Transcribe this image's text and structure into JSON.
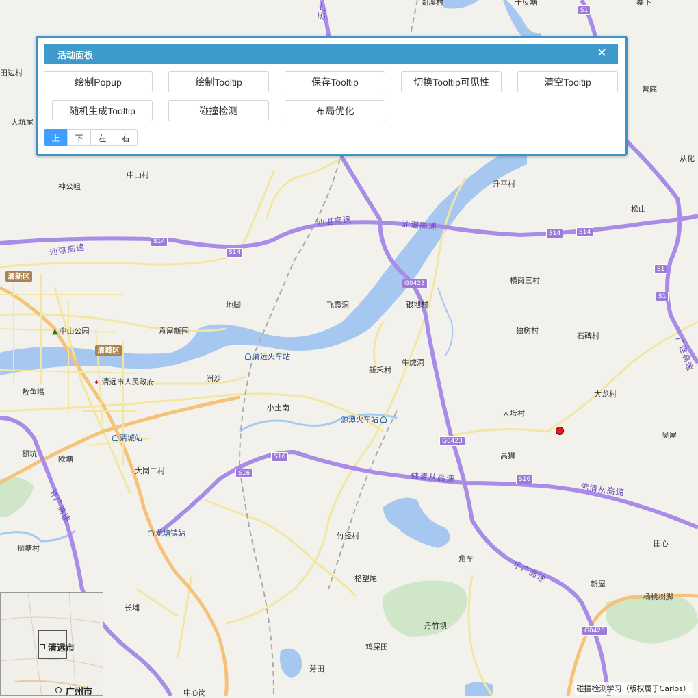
{
  "panel": {
    "title": "活动面板",
    "close_symbol": "✕",
    "buttons": [
      "绘制Popup",
      "绘制Tooltip",
      "保存Tooltip",
      "切换Tooltip可见性",
      "清空Tooltip",
      "随机生成Tooltip",
      "碰撞检测",
      "布局优化"
    ],
    "directions": [
      "上",
      "下",
      "左",
      "右"
    ],
    "active_direction": "上"
  },
  "map": {
    "places": [
      "湖溪村",
      "十反塘",
      "寨下",
      "田边村",
      "营底",
      "大坑尾",
      "从化",
      "中山村",
      "神公咀",
      "升平村",
      "松山",
      "横岗三村",
      "地脚",
      "飞霞洞",
      "银地村",
      "独树村",
      "石碑村",
      "袁屋新围",
      "新禾村",
      "牛虎洞",
      "洲沙",
      "清远市人民政府",
      "敖鱼嘴",
      "小土南",
      "大龙村",
      "大坻村",
      "吴屋",
      "额坑",
      "欧塘",
      "高狮",
      "大岗二村",
      "狮塘村",
      "竹径村",
      "田心",
      "角车",
      "格塑尾",
      "新屋",
      "杨桃树脚",
      "长埔",
      "丹竹坝",
      "鸡屎田",
      "芳田",
      "中心岗"
    ],
    "stations": [
      "清远火车站",
      "源潭火车站",
      "清城站",
      "龙塘镇站"
    ],
    "parks": [
      "中山公园"
    ],
    "districts": [
      "清新区",
      "清城区"
    ],
    "road_names": [
      "汕湛高速",
      "汕湛高速",
      "佛清从高速",
      "佛清从高速",
      "乐广高速",
      "许广高速",
      "广连高速",
      "乐广"
    ],
    "shields": [
      "S1",
      "S14",
      "S14",
      "S14",
      "S14",
      "S1",
      "S1",
      "G0423",
      "G0423",
      "S16",
      "S16",
      "S16",
      "G0423"
    ]
  },
  "overview": {
    "city1": "清远市",
    "city2": "广州市"
  },
  "attribution": "碰撞检测学习（版权属于Carlos）",
  "colors": {
    "panel_border": "#3a96c8",
    "panel_header": "#3d9acb",
    "active_button": "#409eff",
    "water": "#a6c8f0",
    "expressway": "#a98be8",
    "main_road": "#f6c27a",
    "minor_road": "#f3e6a3",
    "marker": "#e21b1b"
  }
}
